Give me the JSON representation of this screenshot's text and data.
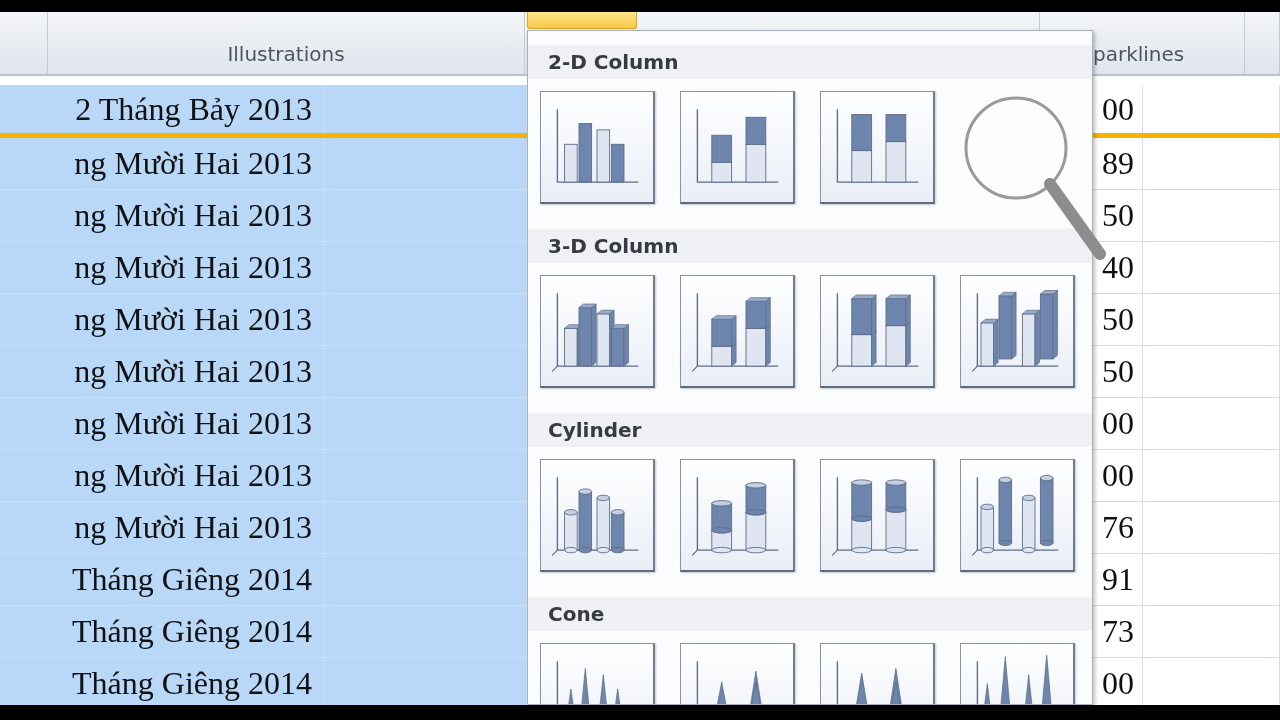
{
  "ribbon": {
    "groups": [
      {
        "label": "Illustrations"
      },
      {
        "label": "parklines"
      }
    ]
  },
  "sheet": {
    "rows": [
      {
        "date": "2 Tháng Bảy 2013",
        "value": "00",
        "selected": true,
        "border_below": true
      },
      {
        "date": "ng Mười Hai 2013",
        "value": "89",
        "selected": true,
        "border_below": false
      },
      {
        "date": "ng Mười Hai 2013",
        "value": "50",
        "selected": true,
        "border_below": false
      },
      {
        "date": "ng Mười Hai 2013",
        "value": "40",
        "selected": true,
        "border_below": false
      },
      {
        "date": "ng Mười Hai 2013",
        "value": "50",
        "selected": true,
        "border_below": false
      },
      {
        "date": "ng Mười Hai 2013",
        "value": "50",
        "selected": true,
        "border_below": false
      },
      {
        "date": "ng Mười Hai 2013",
        "value": "00",
        "selected": true,
        "border_below": false
      },
      {
        "date": "ng Mười Hai 2013",
        "value": "00",
        "selected": true,
        "border_below": false
      },
      {
        "date": "ng Mười Hai 2013",
        "value": "76",
        "selected": true,
        "border_below": false
      },
      {
        "date": "Tháng Giêng 2014",
        "value": "91",
        "selected": true,
        "border_below": false
      },
      {
        "date": "Tháng Giêng 2014",
        "value": "73",
        "selected": true,
        "border_below": false
      },
      {
        "date": "Tháng Giêng 2014",
        "value": "00",
        "selected": true,
        "border_below": false
      }
    ]
  },
  "chart_gallery": {
    "sections": [
      {
        "title": "2-D Column",
        "kind": "column2d",
        "items": [
          {
            "kind": "clustered"
          },
          {
            "kind": "stacked"
          },
          {
            "kind": "stacked100"
          }
        ]
      },
      {
        "title": "3-D Column",
        "kind": "column3d",
        "items": [
          {
            "kind": "clustered"
          },
          {
            "kind": "stacked"
          },
          {
            "kind": "stacked100"
          },
          {
            "kind": "depth"
          }
        ]
      },
      {
        "title": "Cylinder",
        "kind": "cylinder",
        "items": [
          {
            "kind": "clustered"
          },
          {
            "kind": "stacked"
          },
          {
            "kind": "stacked100"
          },
          {
            "kind": "depth"
          }
        ]
      },
      {
        "title": "Cone",
        "kind": "cone",
        "items": [
          {
            "kind": "clustered"
          },
          {
            "kind": "stacked"
          },
          {
            "kind": "stacked100"
          },
          {
            "kind": "depth"
          }
        ]
      }
    ]
  }
}
